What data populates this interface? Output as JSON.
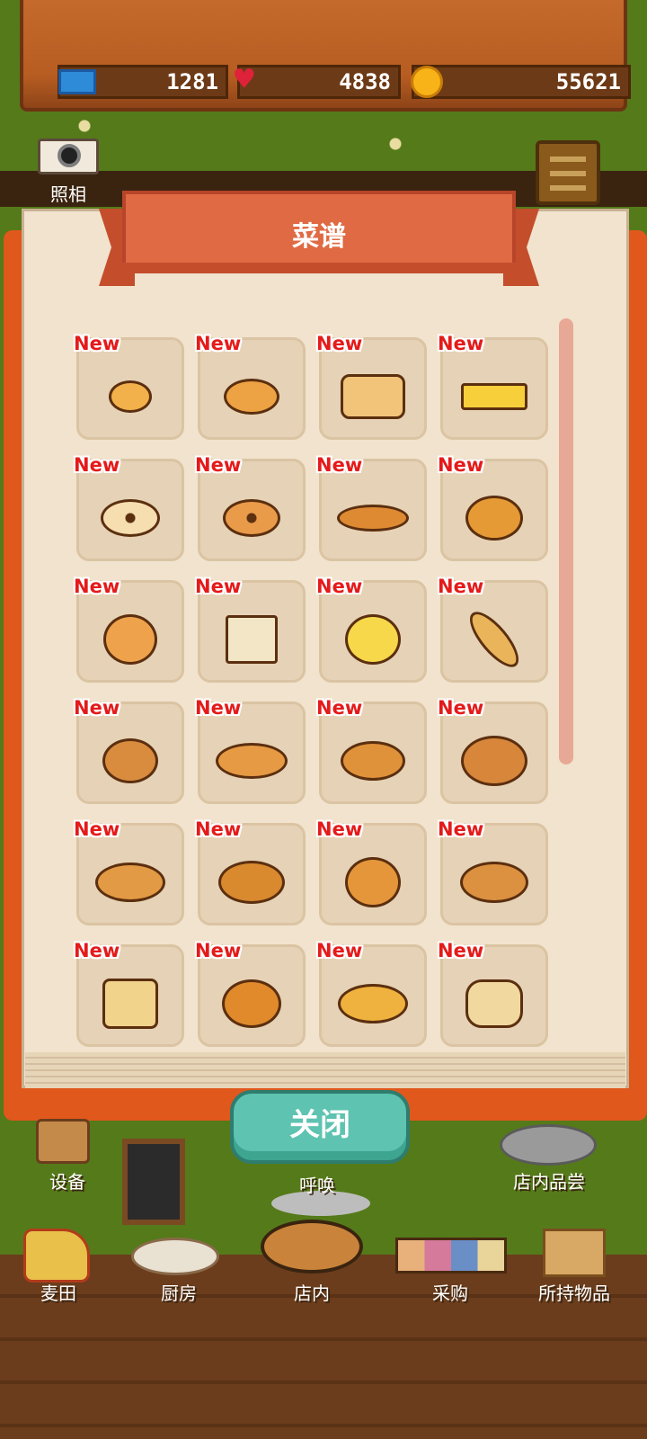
{
  "resources": {
    "tickets": "1281",
    "hearts": "4838",
    "coins": "55621"
  },
  "camera": {
    "label": "照相"
  },
  "recipe_book": {
    "title": "菜谱",
    "new_badge": "New",
    "items": [
      {
        "color": "#f2b14a",
        "shape": "bun-small"
      },
      {
        "color": "#eda243",
        "shape": "bun-oval"
      },
      {
        "color": "#f1c47a",
        "shape": "loaf"
      },
      {
        "color": "#f7cf3a",
        "shape": "sponge"
      },
      {
        "color": "#f6deb0",
        "shape": "bagel"
      },
      {
        "color": "#e99b4a",
        "shape": "donut"
      },
      {
        "color": "#dd8a33",
        "shape": "croissant"
      },
      {
        "color": "#e59a35",
        "shape": "danish"
      },
      {
        "color": "#eea24c",
        "shape": "bunny-bun"
      },
      {
        "color": "#f3e6c6",
        "shape": "sandwich"
      },
      {
        "color": "#f6d84a",
        "shape": "melon-bun"
      },
      {
        "color": "#eab55a",
        "shape": "baguette"
      },
      {
        "color": "#d98b3e",
        "shape": "sprinkle-donut"
      },
      {
        "color": "#e79a44",
        "shape": "pizza-bread"
      },
      {
        "color": "#e0923a",
        "shape": "roll"
      },
      {
        "color": "#d7863a",
        "shape": "jam-danish"
      },
      {
        "color": "#e39a44",
        "shape": "choco-cornet"
      },
      {
        "color": "#d98a2e",
        "shape": "herb-bread"
      },
      {
        "color": "#e5963a",
        "shape": "bear-bun"
      },
      {
        "color": "#dc9140",
        "shape": "choco-roll"
      },
      {
        "color": "#f1d38c",
        "shape": "toast-egg"
      },
      {
        "color": "#e08a2c",
        "shape": "pie"
      },
      {
        "color": "#f0b23e",
        "shape": "cream-horn"
      },
      {
        "color": "#f1d89e",
        "shape": "burger-sandwich"
      }
    ]
  },
  "close_button": {
    "label": "关闭"
  },
  "nav": {
    "equipment": "设备",
    "call": "呼唤",
    "tasting": "店内品尝",
    "wheat_field": "麦田",
    "kitchen": "厨房",
    "shop": "店内",
    "purchase": "采购",
    "inventory": "所持物品"
  }
}
